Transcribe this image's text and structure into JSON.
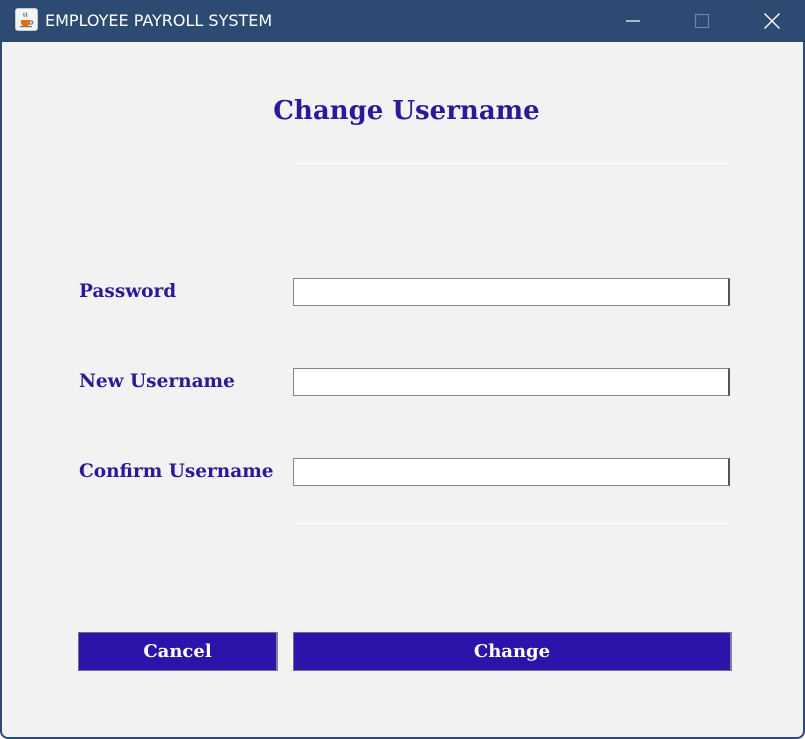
{
  "window": {
    "title": "EMPLOYEE PAYROLL SYSTEM",
    "app_icon": "java-cup-icon",
    "controls": [
      "minimize-icon",
      "maximize-icon",
      "close-icon"
    ]
  },
  "form": {
    "heading": "Change Username",
    "fields": [
      {
        "label": "Password",
        "value": "",
        "placeholder": ""
      },
      {
        "label": "New Username",
        "value": "",
        "placeholder": ""
      },
      {
        "label": "Confirm Username",
        "value": "",
        "placeholder": ""
      }
    ],
    "buttons": {
      "cancel_label": "Cancel",
      "change_label": "Change"
    }
  },
  "colors": {
    "titlebar": "#2c4a72",
    "accent_text": "#2a1a9a",
    "button_bg": "#2c14aa",
    "window_bg": "#f2f2f2"
  }
}
